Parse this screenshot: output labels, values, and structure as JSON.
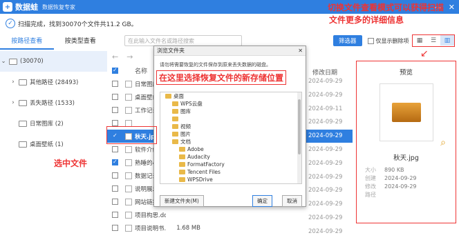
{
  "app": {
    "logo_glyph": "+",
    "name": "数据蛙",
    "subtitle": "数据恢复专家",
    "window_buttons": [
      "—",
      "✕"
    ]
  },
  "status": {
    "text": "扫描完成，找到30070个文件共11.2 GB。"
  },
  "tabs": [
    {
      "label": "按路径查看",
      "active": true
    },
    {
      "label": "按类型查看",
      "active": false
    }
  ],
  "tree": {
    "root_label": "(30070)",
    "items": [
      {
        "label": "其他路径 (28493)",
        "expandable": true
      },
      {
        "label": "丢失路径 (1533)",
        "expandable": true
      },
      {
        "label": "日常图库 (2)",
        "expandable": false
      },
      {
        "label": "桌面壁纸 (1)",
        "expandable": false
      }
    ]
  },
  "search": {
    "placeholder": "在此输入文件名或路径搜索",
    "filter_label": "筛选器",
    "only_deleted_label": "仅显示删除项"
  },
  "list": {
    "header_name": "名称",
    "header_date": "修改日期",
    "rows": [
      {
        "name": "日常图库",
        "size": "",
        "date": "2024-09-29",
        "checked": false,
        "selected": false
      },
      {
        "name": "桌面壁纸",
        "size": "",
        "date": "2024-09-29",
        "checked": false,
        "selected": false
      },
      {
        "name": "工作记录1",
        "size": "",
        "date": "2024-09-11",
        "checked": false,
        "selected": false
      },
      {
        "name": "",
        "size": "",
        "date": "2024-09-29",
        "checked": false,
        "selected": false
      },
      {
        "name": "秋天.jpg",
        "size": "",
        "date": "2024-09-29",
        "checked": true,
        "selected": true
      },
      {
        "name": "软件介绍",
        "size": "",
        "date": "2024-09-29",
        "checked": false,
        "selected": false
      },
      {
        "name": "熟睡的小猫",
        "size": "",
        "date": "2024-09-29",
        "checked": true,
        "selected": false
      },
      {
        "name": "数据记录表",
        "size": "",
        "date": "2024-09-29",
        "checked": false,
        "selected": false
      },
      {
        "name": "说明展示.pdf",
        "size": "",
        "date": "2024-09-29",
        "checked": false,
        "selected": false
      },
      {
        "name": "网站链接.txt",
        "size": "",
        "date": "2024-09-29",
        "checked": false,
        "selected": false
      },
      {
        "name": "项目构思.docx",
        "size": "",
        "date": "2024-09-29",
        "checked": false,
        "selected": false
      },
      {
        "name": "项目说明书.docx",
        "size": "1.68 MB",
        "date": "2024-09-29",
        "checked": false,
        "selected": false
      }
    ]
  },
  "view_toggle": {
    "icons": [
      "grid-view",
      "list-view",
      "preview-view"
    ],
    "selected": 2,
    "glyphs": [
      "▦",
      "☰",
      "▥"
    ]
  },
  "preview": {
    "title": "预览",
    "file_name": "秋天.jpg",
    "meta": [
      {
        "key": "大小",
        "value": "890 KB"
      },
      {
        "key": "创建",
        "value": "2024-09-29"
      },
      {
        "key": "修改",
        "value": "2024-09-29"
      },
      {
        "key": "路径",
        "value": ""
      }
    ]
  },
  "dialog": {
    "title": "浏览文件夹",
    "close": "✕",
    "description": "请勿将需要恢复的文件保存到原来丢失数据的磁盘。",
    "tree": [
      {
        "label": "桌面",
        "indent": 0
      },
      {
        "label": "WPS云盘",
        "indent": 1
      },
      {
        "label": "图库",
        "indent": 1
      },
      {
        "label": "",
        "indent": 1
      },
      {
        "label": "视频",
        "indent": 1
      },
      {
        "label": "图片",
        "indent": 1
      },
      {
        "label": "文档",
        "indent": 1
      },
      {
        "label": "Adobe",
        "indent": 2
      },
      {
        "label": "Audacity",
        "indent": 2
      },
      {
        "label": "FormatFactory",
        "indent": 2
      },
      {
        "label": "Tencent Files",
        "indent": 2
      },
      {
        "label": "WPSDrive",
        "indent": 2
      }
    ],
    "new_folder_label": "新建文件夹(M)",
    "ok_label": "确定",
    "cancel_label": "取消"
  },
  "annotations": {
    "dialog_note": "在这里选择恢复文件的新存储位置",
    "toggle_note_line1": "切换文件查看模式可以获得扫描",
    "toggle_note_line2": "文件更多的详细信息",
    "select_note": "选中文件"
  },
  "colors": {
    "accent": "#2f7fe0",
    "annotation": "#e33333"
  }
}
